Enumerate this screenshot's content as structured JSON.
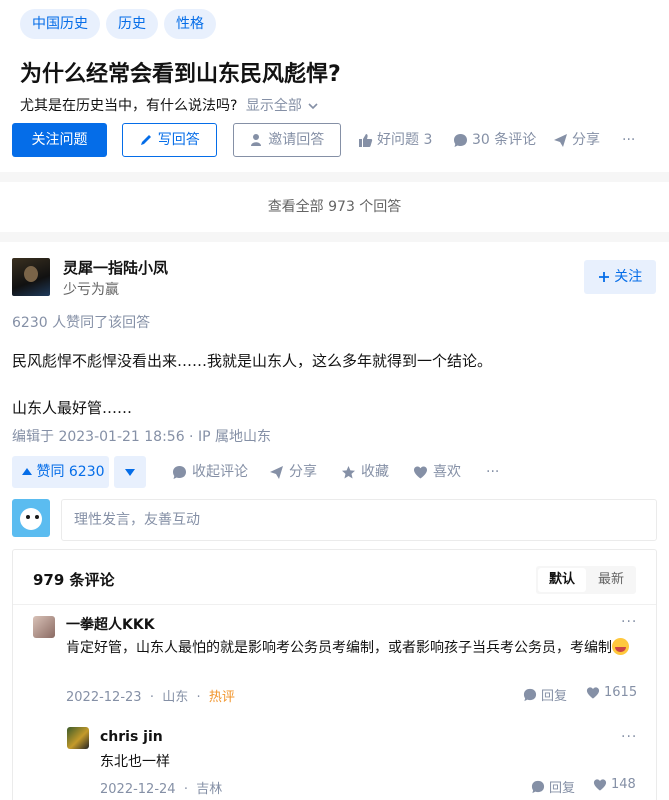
{
  "question": {
    "tags": [
      "中国历史",
      "历史",
      "性格"
    ],
    "title": "为什么经常会看到山东民风彪悍?",
    "detail": "尤其是在历史当中，有什么说法吗?",
    "show_all": "显示全部",
    "follow_label": "关注问题",
    "write_label": "写回答",
    "invite_label": "邀请回答",
    "good_question": "好问题 3",
    "comments": "30 条评论",
    "share": "分享",
    "more": "···"
  },
  "all_answers_label": "查看全部 973 个回答",
  "answer": {
    "author_name": "灵犀一指陆小凤",
    "author_bio": "少亏为赢",
    "follow_label": "关注",
    "voters": "6230 人赞同了该回答",
    "paragraph1": "民风彪悍不彪悍没看出来……我就是山东人，这么多年就得到一个结论。",
    "paragraph2": "山东人最好管……",
    "edited": "编辑于 2023-01-21 18:56 · IP 属地山东",
    "upvote": "赞同 6230",
    "collapse_comments": "收起评论",
    "share": "分享",
    "collect": "收藏",
    "like": "喜欢",
    "more": "···"
  },
  "comment_input_placeholder": "理性发言，友善互动",
  "comments": {
    "count": "979 条评论",
    "sort_default": "默认",
    "sort_newest": "最新",
    "items": [
      {
        "name": "一拳超人KKK",
        "text": "肯定好管，山东人最怕的就是影响考公务员考编制，或者影响孩子当兵考公务员，考编制",
        "date": "2022-12-23",
        "location": "山东",
        "hot": "热评",
        "reply": "回复",
        "likes": "1615",
        "more": "···"
      },
      {
        "name": "chris jin",
        "text": "东北也一样",
        "date": "2022-12-24",
        "location": "吉林",
        "reply": "回复",
        "likes": "148",
        "more": "···"
      }
    ]
  },
  "colors": {
    "brand_blue": "#056de8",
    "light_blue": "#e8f0fd",
    "gray_text": "#8590a6",
    "hot_orange": "#f1942b"
  }
}
